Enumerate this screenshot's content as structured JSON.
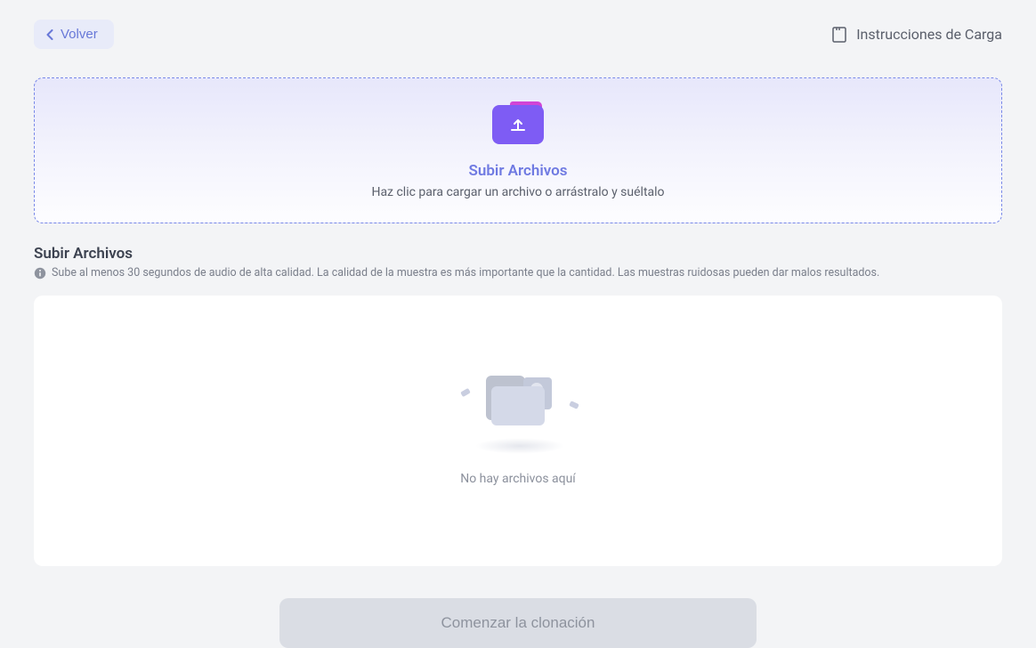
{
  "header": {
    "back_label": "Volver",
    "instructions_label": "Instrucciones de Carga"
  },
  "upload": {
    "title": "Subir Archivos",
    "subtitle": "Haz clic para cargar un archivo o arrástralo y suéltalo"
  },
  "section": {
    "title": "Subir Archivos",
    "info": "Sube al menos 30 segundos de audio de alta calidad. La calidad de la muestra es más importante que la cantidad. Las muestras ruidosas pueden dar malos resultados."
  },
  "files_panel": {
    "empty_text": "No hay archivos aquí"
  },
  "action": {
    "start_label": "Comenzar la clonación"
  }
}
